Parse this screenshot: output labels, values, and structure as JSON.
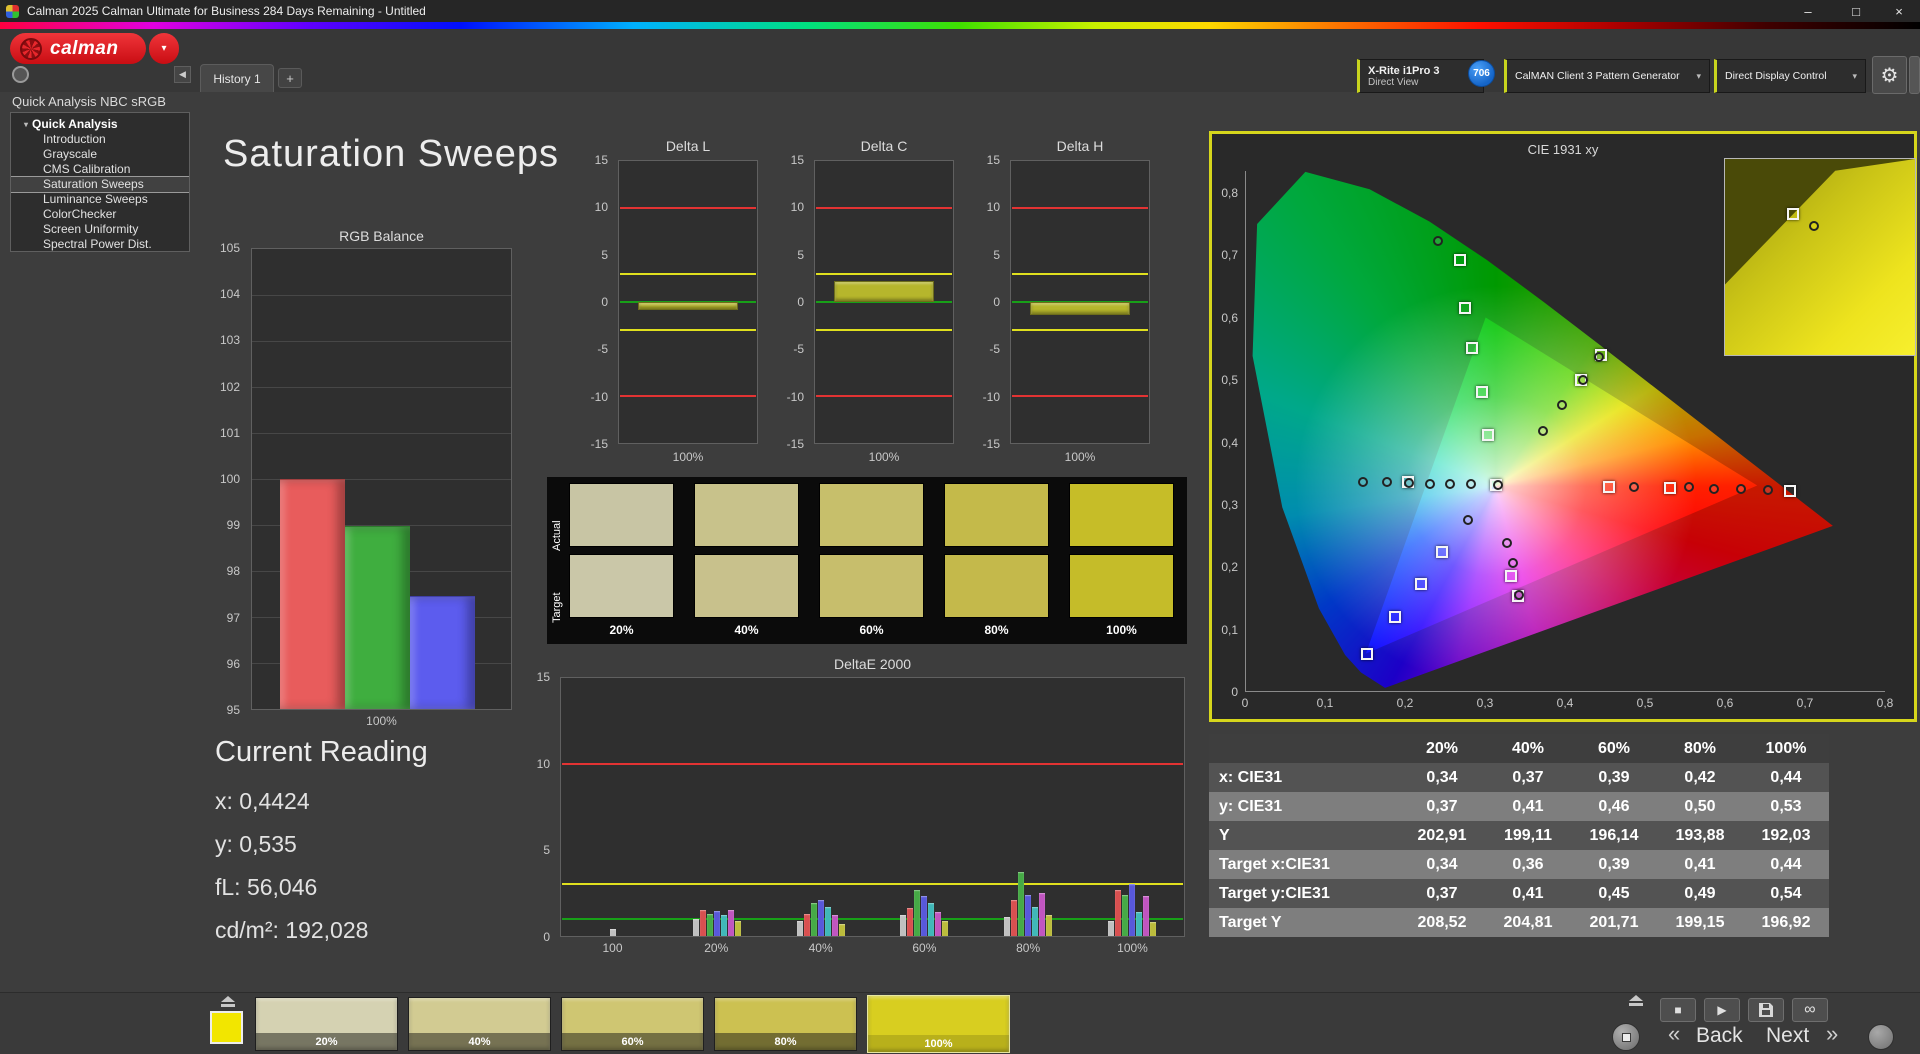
{
  "window": {
    "title": "Calman 2025 Calman Ultimate for Business 284 Days Remaining  - Untitled",
    "minimize": "–",
    "maximize": "□",
    "close": "×"
  },
  "toolbar": {
    "logo_text": "calman",
    "tab_label": "History 1",
    "tab_add": "+",
    "meter_line1": "X-Rite i1Pro 3",
    "meter_line2": "Direct View",
    "badge": "706",
    "pattern_generator": "CalMAN Client 3 Pattern Generator",
    "display_control": "Direct Display Control",
    "accent_color": "#c8d41e"
  },
  "sidebar": {
    "workflow_title": "Quick Analysis NBC sRGB",
    "root_label": "Quick Analysis",
    "items": [
      {
        "label": "Introduction",
        "selected": false
      },
      {
        "label": "Grayscale",
        "selected": false
      },
      {
        "label": "CMS Calibration",
        "selected": false
      },
      {
        "label": "Saturation Sweeps",
        "selected": true
      },
      {
        "label": "Luminance Sweeps",
        "selected": false
      },
      {
        "label": "ColorChecker",
        "selected": false
      },
      {
        "label": "Screen Uniformity",
        "selected": false
      },
      {
        "label": "Spectral Power Dist.",
        "selected": false
      }
    ]
  },
  "main": {
    "page_title": "Saturation Sweeps"
  },
  "current_reading": {
    "title": "Current Reading",
    "lines": [
      "x: 0,4424",
      "y: 0,535",
      "fL: 56,046",
      "cd/m²: 192,028"
    ]
  },
  "swatch_panel": {
    "row_labels": [
      "Actual",
      "Target"
    ],
    "col_labels": [
      "20%",
      "40%",
      "60%",
      "80%",
      "100%"
    ],
    "actual_colors": [
      "#c8c5a4",
      "#c8c28b",
      "#c7bf6b",
      "#c4ba4a",
      "#c6bd28"
    ],
    "target_colors": [
      "#cac7a8",
      "#c8c18c",
      "#c7be6c",
      "#c4b94b",
      "#c5bc29"
    ]
  },
  "table": {
    "header": [
      "",
      "20%",
      "40%",
      "60%",
      "80%",
      "100%"
    ],
    "rows": [
      {
        "label": "x: CIE31",
        "values": [
          "0,34",
          "0,37",
          "0,39",
          "0,42",
          "0,44"
        ]
      },
      {
        "label": "y: CIE31",
        "values": [
          "0,37",
          "0,41",
          "0,46",
          "0,50",
          "0,53"
        ]
      },
      {
        "label": "Y",
        "values": [
          "202,91",
          "199,11",
          "196,14",
          "193,88",
          "192,03"
        ]
      },
      {
        "label": "Target x:CIE31",
        "values": [
          "0,34",
          "0,36",
          "0,39",
          "0,41",
          "0,44"
        ]
      },
      {
        "label": "Target y:CIE31",
        "values": [
          "0,37",
          "0,41",
          "0,45",
          "0,49",
          "0,54"
        ]
      },
      {
        "label": "Target Y",
        "values": [
          "208,52",
          "204,81",
          "201,71",
          "199,15",
          "196,92"
        ]
      }
    ]
  },
  "bottom_bar": {
    "active_patch_color": "#f2e600",
    "swatches": [
      {
        "label": "20%",
        "color": "#d5d2b2",
        "selected": false
      },
      {
        "label": "40%",
        "color": "#d2cb92",
        "selected": false
      },
      {
        "label": "60%",
        "color": "#cfc672",
        "selected": false
      },
      {
        "label": "80%",
        "color": "#ccc151",
        "selected": false
      },
      {
        "label": "100%",
        "color": "#d8ce20",
        "selected": true
      }
    ],
    "back_chevron": "«",
    "back_label": "Back",
    "next_label": "Next",
    "next_chevron": "»"
  },
  "chart_data": [
    {
      "id": "rgb_balance",
      "type": "bar",
      "title": "RGB Balance",
      "categories": [
        "Red",
        "Green",
        "Blue"
      ],
      "values": [
        100,
        98.97,
        97.45
      ],
      "colors": [
        "#e85c5c",
        "#3fae3f",
        "#5c5cee"
      ],
      "ylim": [
        95,
        105
      ],
      "yticks": [
        105,
        104,
        103,
        102,
        101,
        100,
        99,
        98,
        97,
        96,
        95
      ],
      "xlabel": "100%"
    },
    {
      "id": "delta_l",
      "type": "delta_bar",
      "title": "Delta L",
      "value": -0.8,
      "ylim": [
        -15,
        15
      ],
      "yticks": [
        15,
        10,
        5,
        0,
        -5,
        -10,
        -15
      ],
      "ref_lines": [
        {
          "v": 10,
          "color": "#e23333"
        },
        {
          "v": -10,
          "color": "#e23333"
        },
        {
          "v": 3,
          "color": "#e0e01e"
        },
        {
          "v": -3,
          "color": "#e0e01e"
        },
        {
          "v": 0,
          "color": "#18a018"
        }
      ],
      "bar_color": "#b6b62c",
      "xlabel": "100%"
    },
    {
      "id": "delta_c",
      "type": "delta_bar",
      "title": "Delta C",
      "value": 2.2,
      "ylim": [
        -15,
        15
      ],
      "yticks": [
        15,
        10,
        5,
        0,
        -5,
        -10,
        -15
      ],
      "ref_lines": [
        {
          "v": 10,
          "color": "#e23333"
        },
        {
          "v": -10,
          "color": "#e23333"
        },
        {
          "v": 3,
          "color": "#e0e01e"
        },
        {
          "v": -3,
          "color": "#e0e01e"
        },
        {
          "v": 0,
          "color": "#18a018"
        }
      ],
      "bar_color": "#b6b62c",
      "xlabel": "100%"
    },
    {
      "id": "delta_h",
      "type": "delta_bar",
      "title": "Delta H",
      "value": -1.4,
      "ylim": [
        -15,
        15
      ],
      "yticks": [
        15,
        10,
        5,
        0,
        -5,
        -10,
        -15
      ],
      "ref_lines": [
        {
          "v": 10,
          "color": "#e23333"
        },
        {
          "v": -10,
          "color": "#e23333"
        },
        {
          "v": 3,
          "color": "#e0e01e"
        },
        {
          "v": -3,
          "color": "#e0e01e"
        },
        {
          "v": 0,
          "color": "#18a018"
        }
      ],
      "bar_color": "#b6b62c",
      "xlabel": "100%"
    },
    {
      "id": "deltae2000",
      "type": "grouped_bar",
      "title": "DeltaE 2000",
      "categories": [
        "100",
        "20%",
        "40%",
        "60%",
        "80%",
        "100%"
      ],
      "group_centers": [
        8.4,
        25,
        41.7,
        58.3,
        74.9,
        91.6
      ],
      "series_colors": [
        "#c0c0c0",
        "#d85050",
        "#46aa46",
        "#5858da",
        "#40b8b8",
        "#c055c0",
        "#bcbc3c"
      ],
      "groups": [
        [
          0.4
        ],
        [
          1.0,
          1.5,
          1.3,
          1.45,
          1.2,
          1.5,
          0.9
        ],
        [
          0.9,
          1.3,
          1.9,
          2.1,
          1.7,
          1.2,
          0.7
        ],
        [
          1.2,
          1.6,
          2.7,
          2.3,
          1.9,
          1.4,
          0.9
        ],
        [
          1.1,
          2.1,
          3.7,
          2.4,
          1.7,
          2.5,
          1.2
        ],
        [
          0.9,
          2.7,
          2.4,
          3.0,
          1.4,
          2.3,
          0.8
        ]
      ],
      "ylim": [
        0,
        15
      ],
      "yticks": [
        15,
        10,
        5,
        0
      ],
      "ref_lines": [
        {
          "v": 10,
          "color": "#e23333"
        },
        {
          "v": 3,
          "color": "#e0e01e"
        },
        {
          "v": 1,
          "color": "#18a018"
        }
      ]
    },
    {
      "id": "cie1931",
      "type": "scatter",
      "title": "CIE 1931 xy",
      "xlim": [
        0,
        0.8
      ],
      "ylim": [
        0,
        0.8
      ],
      "xticks": [
        "0",
        "0,1",
        "0,2",
        "0,3",
        "0,4",
        "0,5",
        "0,6",
        "0,7",
        "0,8"
      ],
      "yticks": [
        "0",
        "0,1",
        "0,2",
        "0,3",
        "0,4",
        "0,5",
        "0,6",
        "0,7",
        "0,8"
      ],
      "targets": [
        [
          0.268,
          0.693
        ],
        [
          0.274,
          0.616
        ],
        [
          0.283,
          0.551
        ],
        [
          0.295,
          0.48
        ],
        [
          0.303,
          0.411
        ],
        [
          0.313,
          0.331
        ],
        [
          0.203,
          0.336
        ],
        [
          0.454,
          0.328
        ],
        [
          0.531,
          0.326
        ],
        [
          0.681,
          0.322
        ],
        [
          0.246,
          0.223
        ],
        [
          0.219,
          0.172
        ],
        [
          0.187,
          0.119
        ],
        [
          0.151,
          0.06
        ],
        [
          0.332,
          0.184
        ],
        [
          0.34,
          0.152
        ],
        [
          0.445,
          0.54
        ],
        [
          0.419,
          0.5
        ]
      ],
      "measured": [
        [
          0.24,
          0.723
        ],
        [
          0.442,
          0.537
        ],
        [
          0.422,
          0.5
        ],
        [
          0.396,
          0.46
        ],
        [
          0.372,
          0.417
        ],
        [
          0.486,
          0.328
        ],
        [
          0.555,
          0.327
        ],
        [
          0.586,
          0.325
        ],
        [
          0.62,
          0.324
        ],
        [
          0.653,
          0.323
        ],
        [
          0.147,
          0.335
        ],
        [
          0.176,
          0.335
        ],
        [
          0.204,
          0.334
        ],
        [
          0.23,
          0.333
        ],
        [
          0.256,
          0.333
        ],
        [
          0.282,
          0.332
        ],
        [
          0.316,
          0.331
        ],
        [
          0.327,
          0.237
        ],
        [
          0.334,
          0.205
        ],
        [
          0.342,
          0.154
        ],
        [
          0.278,
          0.274
        ]
      ]
    }
  ]
}
